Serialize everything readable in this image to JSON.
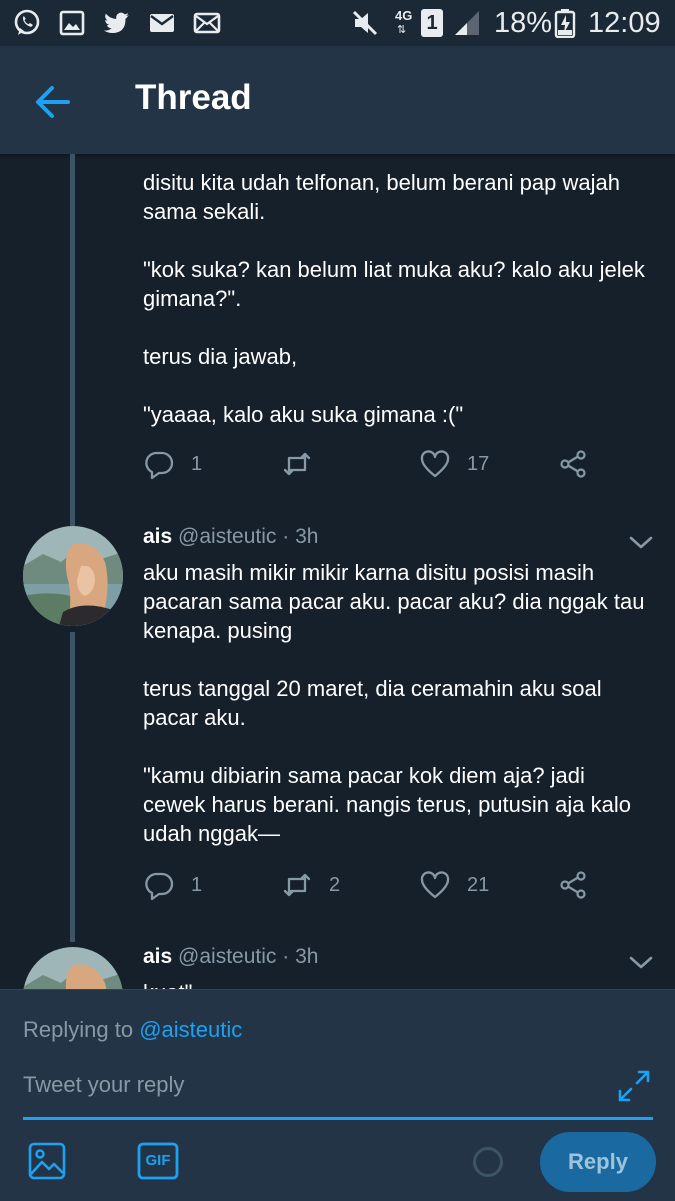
{
  "status_bar": {
    "left_icons": [
      "whatsapp-icon",
      "gallery-icon",
      "twitter-icon",
      "mail-icon",
      "email-icon"
    ],
    "network": "4G",
    "sim": "1",
    "battery": "18%",
    "time": "12:09"
  },
  "header": {
    "title": "Thread",
    "back_icon": "arrow-left-icon"
  },
  "tweets": [
    {
      "text": "disitu kita udah telfonan, belum berani pap wajah sama sekali.\n\n\"kok suka? kan belum liat muka aku? kalo aku jelek gimana?\".\n\nterus dia jawab,\n\n\"yaaaa, kalo aku suka gimana :(\"",
      "replies": "1",
      "retweets": "",
      "likes": "17"
    },
    {
      "name": "ais",
      "handle": "@aisteutic",
      "time": "· 3h",
      "text": "aku masih mikir mikir karna disitu posisi masih pacaran sama pacar aku. pacar aku? dia nggak tau kenapa. pusing\n\nterus tanggal 20 maret, dia ceramahin aku soal pacar aku.\n\n\"kamu dibiarin sama pacar kok diem aja? jadi cewek harus berani. nangis terus, putusin aja kalo udah nggak—",
      "replies": "1",
      "retweets": "2",
      "likes": "21"
    },
    {
      "name": "ais",
      "handle": "@aisteutic",
      "time": "· 3h",
      "text": "kuat\""
    }
  ],
  "composer": {
    "replying_prefix": "Replying to",
    "replying_handle": "@aisteutic",
    "placeholder": "Tweet your reply",
    "gif_label": "GIF",
    "reply_label": "Reply"
  },
  "colors": {
    "background": "#15202b",
    "header": "#243447",
    "accent": "#1da1f2",
    "muted_text": "#8899a6",
    "reply_button": "#1a6aa1"
  }
}
